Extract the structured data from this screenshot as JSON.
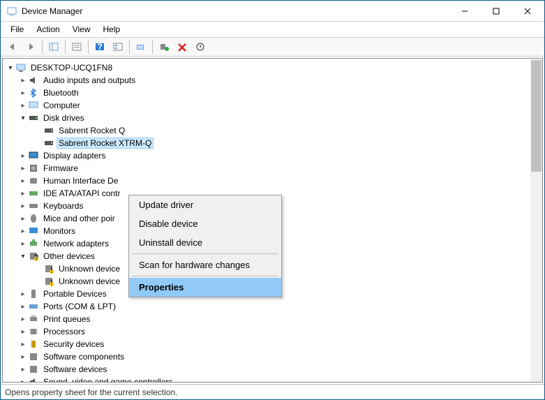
{
  "window": {
    "title": "Device Manager"
  },
  "menu": {
    "file": "File",
    "action": "Action",
    "view": "View",
    "help": "Help"
  },
  "tree": {
    "root": "DESKTOP-UCQ1FN8",
    "audio": "Audio inputs and outputs",
    "bluetooth": "Bluetooth",
    "computer": "Computer",
    "disk": "Disk drives",
    "disk_a": "Sabrent Rocket Q",
    "disk_b": "Sabrent Rocket XTRM-Q",
    "display": "Display adapters",
    "firmware": "Firmware",
    "hid": "Human Interface De",
    "ide": "IDE ATA/ATAPI contr",
    "keyboards": "Keyboards",
    "mice": "Mice and other poir",
    "monitors": "Monitors",
    "network": "Network adapters",
    "other": "Other devices",
    "unknown1": "Unknown device",
    "unknown2": "Unknown device",
    "portable": "Portable Devices",
    "ports": "Ports (COM & LPT)",
    "printq": "Print queues",
    "processors": "Processors",
    "security": "Security devices",
    "softcomp": "Software components",
    "softdev": "Software devices",
    "sound": "Sound, video and game controllers"
  },
  "context": {
    "update": "Update driver",
    "disable": "Disable device",
    "uninstall": "Uninstall device",
    "scan": "Scan for hardware changes",
    "properties": "Properties"
  },
  "status": "Opens property sheet for the current selection."
}
